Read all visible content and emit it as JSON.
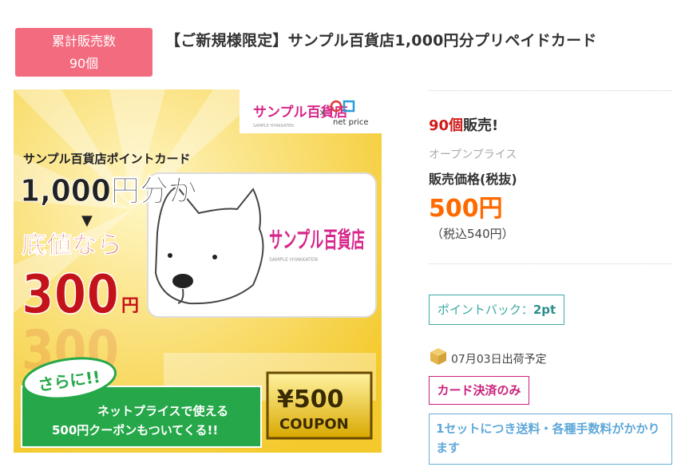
{
  "badge": {
    "line1": "累計販売数",
    "line2": "90個"
  },
  "title": "【ご新規様限定】サンプル百貨店1,000円分プリペイドカード",
  "banner": {
    "logo_name": "サンプル百貨店",
    "logo_sub": "SAMPLE HYAKKATEN",
    "cross": "×",
    "partner": "net price",
    "headline": "サンプル百貨店ポイントカード",
    "amount": "1,000円分が",
    "arrow": "▼",
    "cheap": "底値なら",
    "price": "300",
    "yen": "円",
    "card_logo": "サンプル百貨店",
    "card_sub": "SAMPLE HYAKKATEN",
    "sarani": "さらに!!",
    "coupon_line1": "ネットプライスで使える",
    "coupon_line2": "500円クーポンもついてくる!!",
    "coupon_amount": "¥500",
    "coupon_word": "COUPON"
  },
  "sold": {
    "count": "90個",
    "suffix": "販売!"
  },
  "open_price": "オープンプライス",
  "price_label": "販売価格(税抜)",
  "price": "500円",
  "tax_included": "（税込540円）",
  "point_back": {
    "label": "ポイントバック：",
    "value": "2pt"
  },
  "ship": {
    "icon": "package-icon",
    "text": "07月03日出荷予定"
  },
  "card_only": "カード決済のみ",
  "fee_note": "1セットにつき送料・各種手数料がかかります",
  "colors": {
    "badge": "#f36b7f",
    "price": "#ff6a00",
    "sold": "#d11a1a",
    "point": "#3aa9a5",
    "card_only": "#c8237d",
    "fee": "#5fa8d8"
  }
}
